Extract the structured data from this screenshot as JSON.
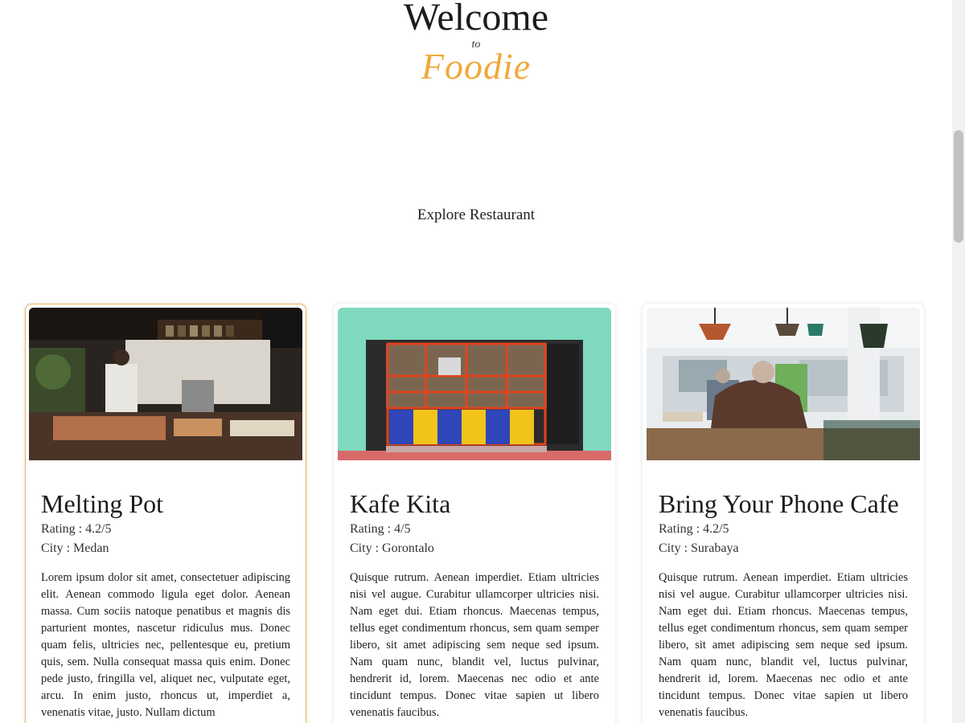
{
  "hero": {
    "welcome": "Welcome",
    "to": "to",
    "brand": "Foodie",
    "brand_color": "#f0a93b"
  },
  "section": {
    "title": "Explore Restaurant"
  },
  "restaurants": [
    {
      "name": "Melting Pot",
      "rating": "Rating : 4.2/5",
      "city": "City : Medan",
      "description": "Lorem ipsum dolor sit amet, consectetuer adipiscing elit. Aenean commodo ligula eget dolor. Aenean massa. Cum sociis natoque penatibus et magnis dis parturient montes, nascetur ridiculus mus. Donec quam felis, ultricies nec, pellentesque eu, pretium quis, sem. Nulla consequat massa quis enim. Donec pede justo, fringilla vel, aliquet nec, vulputate eget, arcu. In enim justo, rhoncus ut, imperdiet a, venenatis vitae, justo. Nullam dictum",
      "image": "restaurant-kitchen-photo"
    },
    {
      "name": "Kafe Kita",
      "rating": "Rating : 4/5",
      "city": "City : Gorontalo",
      "description": "Quisque rutrum. Aenean imperdiet. Etiam ultricies nisi vel augue. Curabitur ullamcorper ultricies nisi. Nam eget dui. Etiam rhoncus. Maecenas tempus, tellus eget condimentum rhoncus, sem quam semper libero, sit amet adipiscing sem neque sed ipsum. Nam quam nunc, blandit vel, luctus pulvinar, hendrerit id, lorem. Maecenas nec odio et ante tincidunt tempus. Donec vitae sapien ut libero venenatis faucibus.",
      "image": "colorful-storefront-photo"
    },
    {
      "name": "Bring Your Phone Cafe",
      "rating": "Rating : 4.2/5",
      "city": "City : Surabaya",
      "description": "Quisque rutrum. Aenean imperdiet. Etiam ultricies nisi vel augue. Curabitur ullamcorper ultricies nisi. Nam eget dui. Etiam rhoncus. Maecenas tempus, tellus eget condimentum rhoncus, sem quam semper libero, sit amet adipiscing sem neque sed ipsum. Nam quam nunc, blandit vel, luctus pulvinar, hendrerit id, lorem. Maecenas nec odio et ante tincidunt tempus. Donec vitae sapien ut libero venenatis faucibus.",
      "image": "cafe-interior-photo"
    }
  ]
}
